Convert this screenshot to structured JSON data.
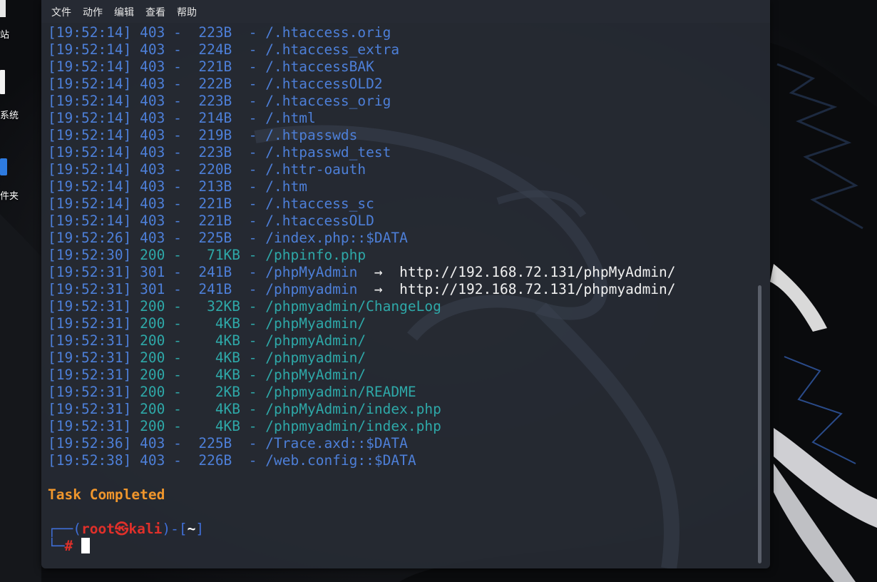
{
  "desktop": {
    "labels": [
      "站",
      "系统",
      "件夹"
    ],
    "icons": [
      "trash-icon",
      "file-system-icon",
      "folder-icon"
    ],
    "wallpaper": "kali-dragon-wallpaper"
  },
  "terminal": {
    "menu": [
      "文件",
      "动作",
      "编辑",
      "查看",
      "帮助"
    ],
    "lines": [
      {
        "ts": "[19:52:14]",
        "status": "403",
        "size": "223B ",
        "path": "/.htaccess.orig"
      },
      {
        "ts": "[19:52:14]",
        "status": "403",
        "size": "224B ",
        "path": "/.htaccess_extra"
      },
      {
        "ts": "[19:52:14]",
        "status": "403",
        "size": "221B ",
        "path": "/.htaccessBAK"
      },
      {
        "ts": "[19:52:14]",
        "status": "403",
        "size": "222B ",
        "path": "/.htaccessOLD2"
      },
      {
        "ts": "[19:52:14]",
        "status": "403",
        "size": "223B ",
        "path": "/.htaccess_orig"
      },
      {
        "ts": "[19:52:14]",
        "status": "403",
        "size": "214B ",
        "path": "/.html"
      },
      {
        "ts": "[19:52:14]",
        "status": "403",
        "size": "219B ",
        "path": "/.htpasswds"
      },
      {
        "ts": "[19:52:14]",
        "status": "403",
        "size": "223B ",
        "path": "/.htpasswd_test"
      },
      {
        "ts": "[19:52:14]",
        "status": "403",
        "size": "220B ",
        "path": "/.httr-oauth"
      },
      {
        "ts": "[19:52:14]",
        "status": "403",
        "size": "213B ",
        "path": "/.htm"
      },
      {
        "ts": "[19:52:14]",
        "status": "403",
        "size": "221B ",
        "path": "/.htaccess_sc"
      },
      {
        "ts": "[19:52:14]",
        "status": "403",
        "size": "221B ",
        "path": "/.htaccessOLD"
      },
      {
        "ts": "[19:52:26]",
        "status": "403",
        "size": "225B ",
        "path": "/index.php::$DATA"
      },
      {
        "ts": "[19:52:30]",
        "status": "200",
        "size": " 71KB",
        "path": "/phpinfo.php"
      },
      {
        "ts": "[19:52:31]",
        "status": "301",
        "size": "241B ",
        "path": "/phpMyAdmin",
        "redirect": "http://192.168.72.131/phpMyAdmin/"
      },
      {
        "ts": "[19:52:31]",
        "status": "301",
        "size": "241B ",
        "path": "/phpmyadmin",
        "redirect": "http://192.168.72.131/phpmyadmin/"
      },
      {
        "ts": "[19:52:31]",
        "status": "200",
        "size": " 32KB",
        "path": "/phpmyadmin/ChangeLog"
      },
      {
        "ts": "[19:52:31]",
        "status": "200",
        "size": "  4KB",
        "path": "/phpMyadmin/"
      },
      {
        "ts": "[19:52:31]",
        "status": "200",
        "size": "  4KB",
        "path": "/phpmyAdmin/"
      },
      {
        "ts": "[19:52:31]",
        "status": "200",
        "size": "  4KB",
        "path": "/phpmyadmin/"
      },
      {
        "ts": "[19:52:31]",
        "status": "200",
        "size": "  4KB",
        "path": "/phpMyAdmin/"
      },
      {
        "ts": "[19:52:31]",
        "status": "200",
        "size": "  2KB",
        "path": "/phpmyadmin/README"
      },
      {
        "ts": "[19:52:31]",
        "status": "200",
        "size": "  4KB",
        "path": "/phpMyAdmin/index.php"
      },
      {
        "ts": "[19:52:31]",
        "status": "200",
        "size": "  4KB",
        "path": "/phpmyadmin/index.php"
      },
      {
        "ts": "[19:52:36]",
        "status": "403",
        "size": "225B ",
        "path": "/Trace.axd::$DATA"
      },
      {
        "ts": "[19:52:38]",
        "status": "403",
        "size": "226B ",
        "path": "/web.config::$DATA"
      }
    ],
    "task_completed": "Task Completed",
    "prompt": {
      "box_top_left": "┌──(",
      "user": "root㉿kali",
      "box_mid": ")-[",
      "dir": "~",
      "box_close": "]",
      "box_bottom": "└─",
      "hash": "#"
    },
    "colors": {
      "timestamp": "#4d7fd8",
      "status_200": "#2ea8a8",
      "task": "#f0962c",
      "prompt_user": "#e0302a"
    }
  }
}
